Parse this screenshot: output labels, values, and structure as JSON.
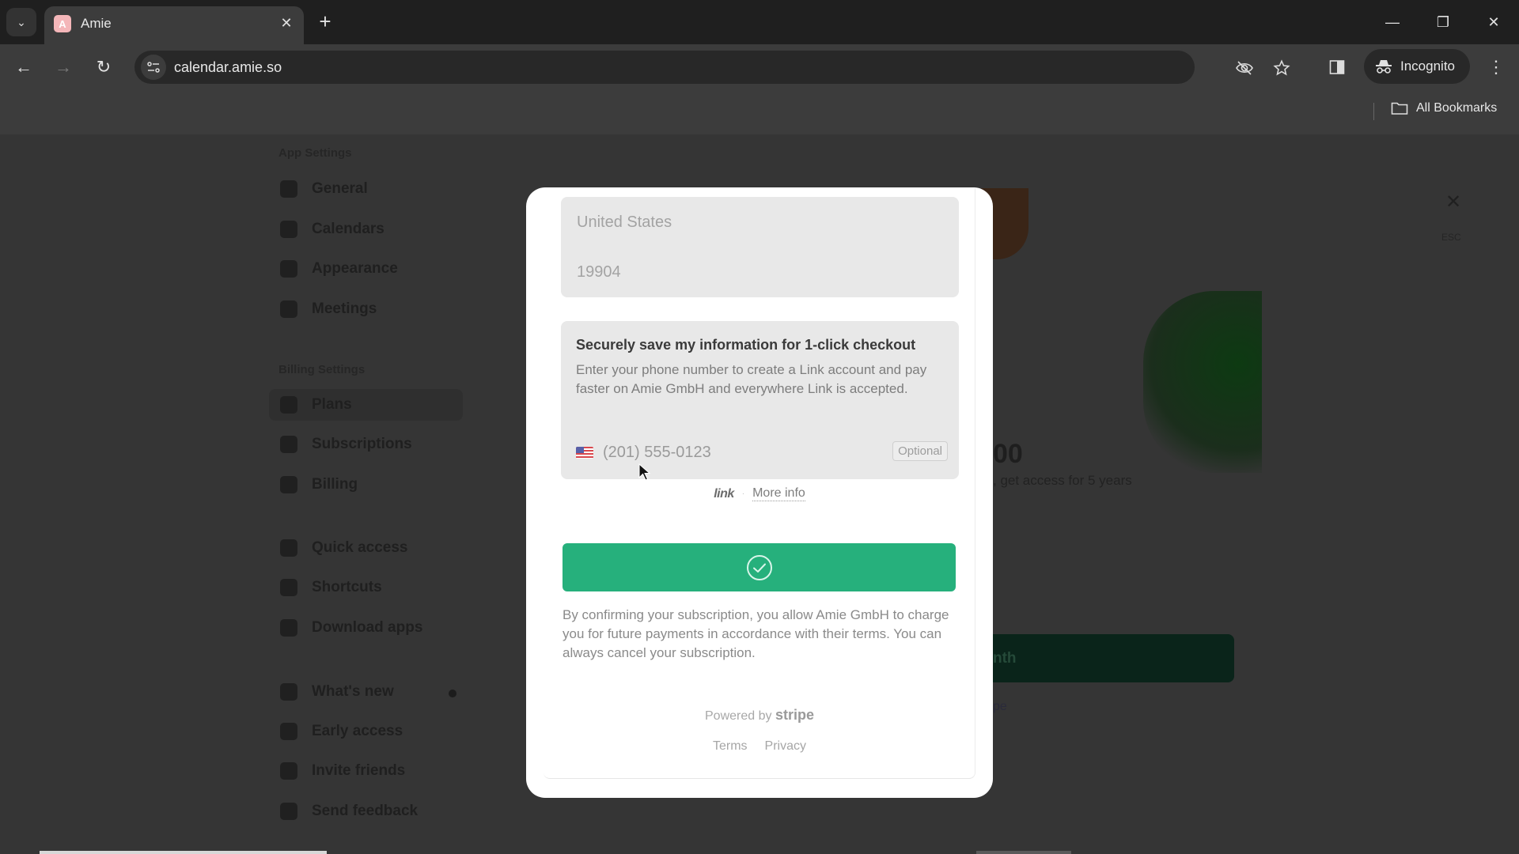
{
  "browser": {
    "tab_title": "Amie",
    "tab_favicon_letter": "A",
    "url": "calendar.amie.so",
    "incognito_label": "Incognito",
    "all_bookmarks_label": "All Bookmarks",
    "icons": {
      "tab_search": "chevron-down-icon",
      "tab_close": "close-icon",
      "new_tab": "plus-icon",
      "back": "back-arrow-icon",
      "forward": "forward-arrow-icon",
      "reload": "reload-icon",
      "site_info": "site-settings-icon",
      "tracking": "eye-off-icon",
      "bookmark": "star-icon",
      "side_panel": "side-panel-icon",
      "incognito": "incognito-icon",
      "menu": "kebab-menu-icon",
      "folder": "folder-icon"
    },
    "glyphs": {
      "chevron": "⌄",
      "close": "✕",
      "plus": "+",
      "back": "←",
      "forward": "→",
      "reload": "↻",
      "minimize": "—",
      "restore": "❐",
      "menu": "⋮"
    }
  },
  "sidebar": {
    "sections": [
      {
        "title": "App Settings",
        "items": [
          {
            "label": "General",
            "icon": "gear-icon"
          },
          {
            "label": "Calendars",
            "icon": "calendar-icon"
          },
          {
            "label": "Appearance",
            "icon": "appearance-icon"
          },
          {
            "label": "Meetings",
            "icon": "video-icon"
          }
        ]
      },
      {
        "title": "Billing Settings",
        "items": [
          {
            "label": "Plans",
            "icon": "plans-icon",
            "active": true
          },
          {
            "label": "Subscriptions",
            "icon": "subscriptions-icon"
          },
          {
            "label": "Billing",
            "icon": "billing-icon"
          }
        ]
      },
      {
        "title": "",
        "items": [
          {
            "label": "Quick access",
            "icon": "quick-access-icon"
          },
          {
            "label": "Shortcuts",
            "icon": "at-icon"
          },
          {
            "label": "Download apps",
            "icon": "download-icon"
          }
        ]
      },
      {
        "title": "",
        "items": [
          {
            "label": "What's new",
            "icon": "flame-icon",
            "badge_dot": true
          },
          {
            "label": "Early access",
            "icon": "rocket-icon"
          },
          {
            "label": "Invite friends",
            "icon": "gift-icon"
          },
          {
            "label": "Send feedback",
            "icon": "megaphone-icon"
          }
        ]
      }
    ]
  },
  "background_plan": {
    "price_fragment": "00",
    "subtitle_fragment": ", get access for 5 years",
    "cta_fragment": "nth",
    "link_fragment": "pe",
    "close_hint": "ESC"
  },
  "checkout": {
    "address": {
      "country": "United States",
      "zip": "19904"
    },
    "link": {
      "title": "Securely save my information for 1-click checkout",
      "description": "Enter your phone number to create a Link account and pay faster on Amie GmbH and everywhere Link is accepted.",
      "phone_placeholder": "(201) 555-0123",
      "country_flag": "us-flag-icon",
      "optional_label": "Optional",
      "logo_text": "link",
      "separator": "·",
      "more_info_label": "More info"
    },
    "confirm_button": {
      "state": "success",
      "icon": "check-circle-icon",
      "color": "#26b07c"
    },
    "legal_text": "By confirming your subscription, you allow Amie GmbH to charge you for future payments in accordance with their terms. You can always cancel your subscription.",
    "powered_by_prefix": "Powered by",
    "powered_by_brand": "stripe",
    "footer_links": [
      "Terms",
      "Privacy"
    ]
  }
}
